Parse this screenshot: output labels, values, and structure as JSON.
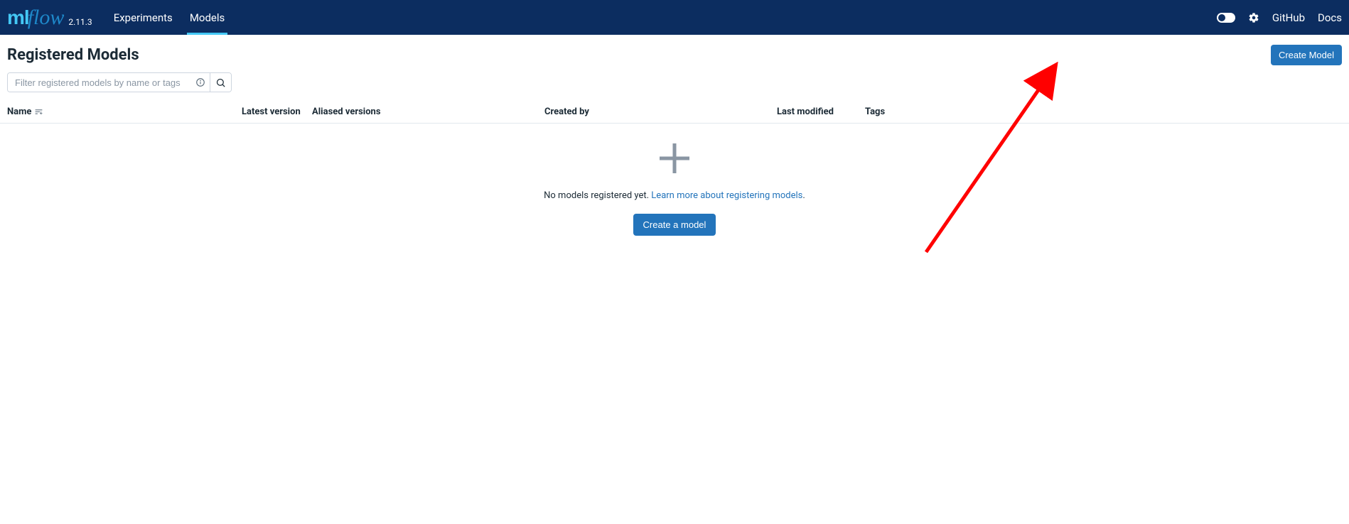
{
  "app": {
    "logo_ml": "ml",
    "logo_flow": "flow",
    "version": "2.11.3"
  },
  "nav": {
    "tabs": [
      {
        "label": "Experiments",
        "active": false
      },
      {
        "label": "Models",
        "active": true
      }
    ]
  },
  "header_links": {
    "github": "GitHub",
    "docs": "Docs"
  },
  "page": {
    "title": "Registered Models",
    "create_button": "Create Model"
  },
  "filter": {
    "placeholder": "Filter registered models by name or tags"
  },
  "columns": {
    "name": "Name",
    "latest_version": "Latest version",
    "aliased_versions": "Aliased versions",
    "created_by": "Created by",
    "last_modified": "Last modified",
    "tags": "Tags"
  },
  "empty": {
    "text": "No models registered yet. ",
    "link": "Learn more about registering models",
    "period": ".",
    "button": "Create a model"
  }
}
